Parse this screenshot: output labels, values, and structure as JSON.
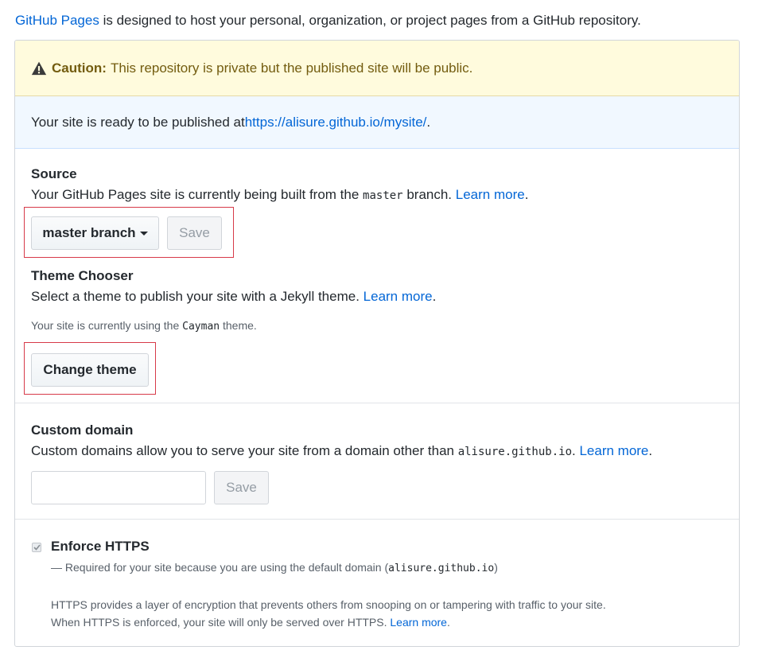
{
  "intro": {
    "link_text": "GitHub Pages",
    "text": " is designed to host your personal, organization, or project pages from a GitHub repository."
  },
  "caution": {
    "label": "Caution:",
    "text": "This repository is private but the published site will be public."
  },
  "ready": {
    "text": "Your site is ready to be published at ",
    "url": "https://alisure.github.io/mysite/",
    "suffix": "."
  },
  "source": {
    "title": "Source",
    "desc_before": "Your GitHub Pages site is currently being built from the ",
    "branch_code": "master",
    "desc_after": " branch. ",
    "learn_more": "Learn more",
    "period": ".",
    "branch_button": "master branch",
    "save_button": "Save"
  },
  "theme": {
    "title": "Theme Chooser",
    "desc": "Select a theme to publish your site with a Jekyll theme. ",
    "learn_more": "Learn more",
    "period": ".",
    "current_before": "Your site is currently using the ",
    "current_theme": "Cayman",
    "current_after": " theme.",
    "change_button": "Change theme"
  },
  "custom_domain": {
    "title": "Custom domain",
    "desc": "Custom domains allow you to serve your site from a domain other than ",
    "domain_code": "alisure.github.io",
    "desc_after": ". ",
    "learn_more": "Learn more",
    "period": ".",
    "input_value": "",
    "input_placeholder": "",
    "save_button": "Save"
  },
  "https": {
    "label": "Enforce HTTPS",
    "checked": true,
    "required_before": "— Required for your site because you are using the default domain (",
    "required_code": "alisure.github.io",
    "required_after": ")",
    "desc_line1": "HTTPS provides a layer of encryption that prevents others from snooping on or tampering with traffic to your site.",
    "desc_line2": "When HTTPS is enforced, your site will only be served over HTTPS. ",
    "learn_more": "Learn more",
    "period": "."
  },
  "colors": {
    "link": "#0366d6",
    "caution_bg": "#fffbdd",
    "caution_text": "#735c0f",
    "info_bg": "#f1f8ff",
    "highlight": "#d73a49"
  },
  "icons": {
    "caution": "alert-triangle-icon",
    "dropdown": "caret-down-icon",
    "checkbox": "checkmark-icon"
  }
}
